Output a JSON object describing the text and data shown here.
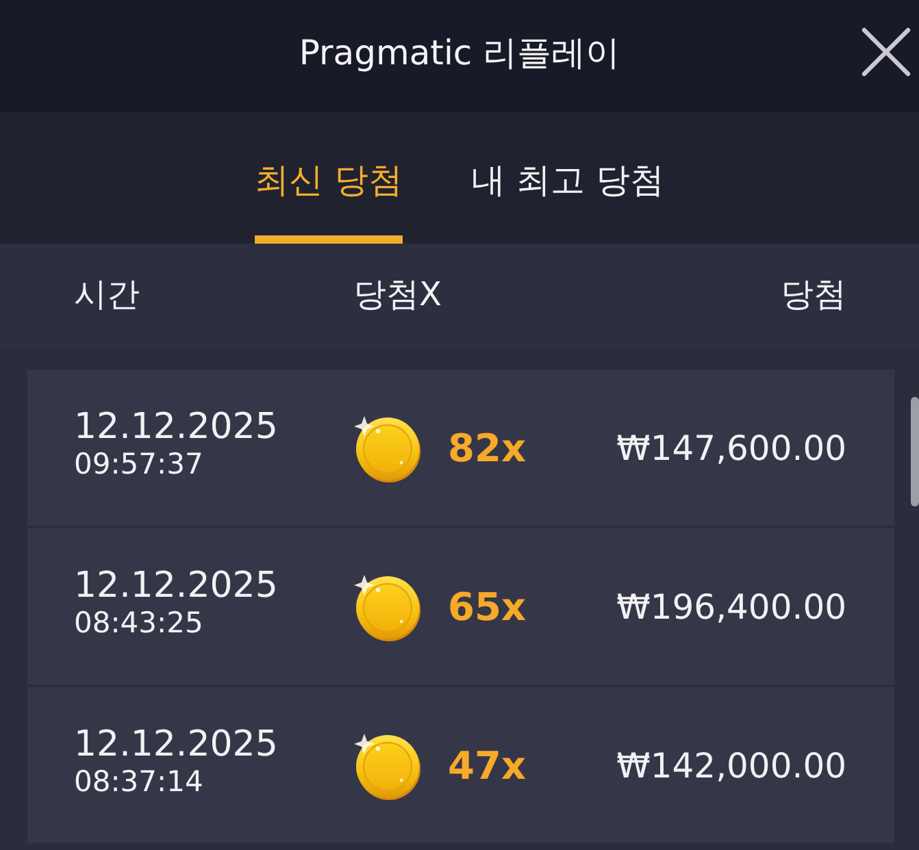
{
  "window": {
    "title": "Pragmatic 리플레이"
  },
  "tabs": [
    {
      "label": "최신 당첨",
      "selected": true
    },
    {
      "label": "내 최고 당첨",
      "selected": false
    }
  ],
  "table": {
    "columns": [
      "시간",
      "당첨X",
      "당첨"
    ],
    "rows": [
      {
        "date": "12.12.2025",
        "time": "09:57:37",
        "multiplier": "82x",
        "win": "₩147,600.00"
      },
      {
        "date": "12.12.2025",
        "time": "08:43:25",
        "multiplier": "65x",
        "win": "₩196,400.00"
      },
      {
        "date": "12.12.2025",
        "time": "08:37:14",
        "multiplier": "47x",
        "win": "₩142,000.00"
      }
    ]
  }
}
